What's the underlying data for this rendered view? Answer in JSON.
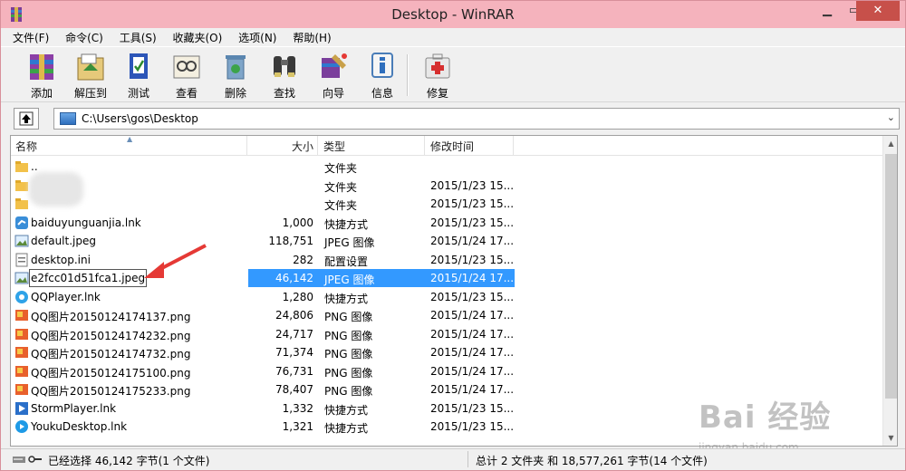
{
  "window": {
    "title": "Desktop - WinRAR"
  },
  "menu": [
    "文件(F)",
    "命令(C)",
    "工具(S)",
    "收藏夹(O)",
    "选项(N)",
    "帮助(H)"
  ],
  "toolbar": {
    "add": "添加",
    "extract": "解压到",
    "test": "测试",
    "view": "查看",
    "delete": "删除",
    "find": "查找",
    "wizard": "向导",
    "info": "信息",
    "repair": "修复"
  },
  "address": {
    "path": "C:\\Users\\gos\\Desktop"
  },
  "columns": {
    "name": "名称",
    "size": "大小",
    "type": "类型",
    "modified": "修改时间"
  },
  "files": [
    {
      "name": "..",
      "size": "",
      "type": "文件夹",
      "modified": "",
      "icon": "folder-icon"
    },
    {
      "name": "",
      "size": "",
      "type": "文件夹",
      "modified": "2015/1/23 15...",
      "icon": "folder-icon"
    },
    {
      "name": "",
      "size": "",
      "type": "文件夹",
      "modified": "2015/1/23 15...",
      "icon": "folder-icon"
    },
    {
      "name": "baiduyunguanjia.lnk",
      "size": "1,000",
      "type": "快捷方式",
      "modified": "2015/1/23 15...",
      "icon": "shortcut-icon"
    },
    {
      "name": "default.jpeg",
      "size": "118,751",
      "type": "JPEG 图像",
      "modified": "2015/1/24 17...",
      "icon": "image-icon"
    },
    {
      "name": "desktop.ini",
      "size": "282",
      "type": "配置设置",
      "modified": "2015/1/23 15...",
      "icon": "ini-icon"
    },
    {
      "name": "e2fcc01d51fca1.jpeg",
      "size": "46,142",
      "type": "JPEG 图像",
      "modified": "2015/1/24 17...",
      "icon": "image-icon",
      "selected": true
    },
    {
      "name": "QQPlayer.lnk",
      "size": "1,280",
      "type": "快捷方式",
      "modified": "2015/1/23 15...",
      "icon": "qqplayer-icon"
    },
    {
      "name": "QQ图片20150124174137.png",
      "size": "24,806",
      "type": "PNG 图像",
      "modified": "2015/1/24 17...",
      "icon": "png-icon"
    },
    {
      "name": "QQ图片20150124174232.png",
      "size": "24,717",
      "type": "PNG 图像",
      "modified": "2015/1/24 17...",
      "icon": "png-icon"
    },
    {
      "name": "QQ图片20150124174732.png",
      "size": "71,374",
      "type": "PNG 图像",
      "modified": "2015/1/24 17...",
      "icon": "png-icon"
    },
    {
      "name": "QQ图片20150124175100.png",
      "size": "76,731",
      "type": "PNG 图像",
      "modified": "2015/1/24 17...",
      "icon": "png-icon"
    },
    {
      "name": "QQ图片20150124175233.png",
      "size": "78,407",
      "type": "PNG 图像",
      "modified": "2015/1/24 17...",
      "icon": "png-icon"
    },
    {
      "name": "StormPlayer.lnk",
      "size": "1,332",
      "type": "快捷方式",
      "modified": "2015/1/23 15...",
      "icon": "stormplayer-icon"
    },
    {
      "name": "YoukuDesktop.lnk",
      "size": "1,321",
      "type": "快捷方式",
      "modified": "2015/1/23 15...",
      "icon": "youku-icon"
    }
  ],
  "status": {
    "left": "已经选择 46,142 字节(1 个文件)",
    "right": "总计 2 文件夹 和 18,577,261 字节(14 个文件)"
  },
  "watermark": {
    "main": "Bai 经验",
    "sub": "jingyan.baidu.com"
  },
  "colors": {
    "titlebar": "#f5b3bd",
    "close": "#c7504a",
    "selection": "#3399ff",
    "arrow": "#e53935"
  }
}
